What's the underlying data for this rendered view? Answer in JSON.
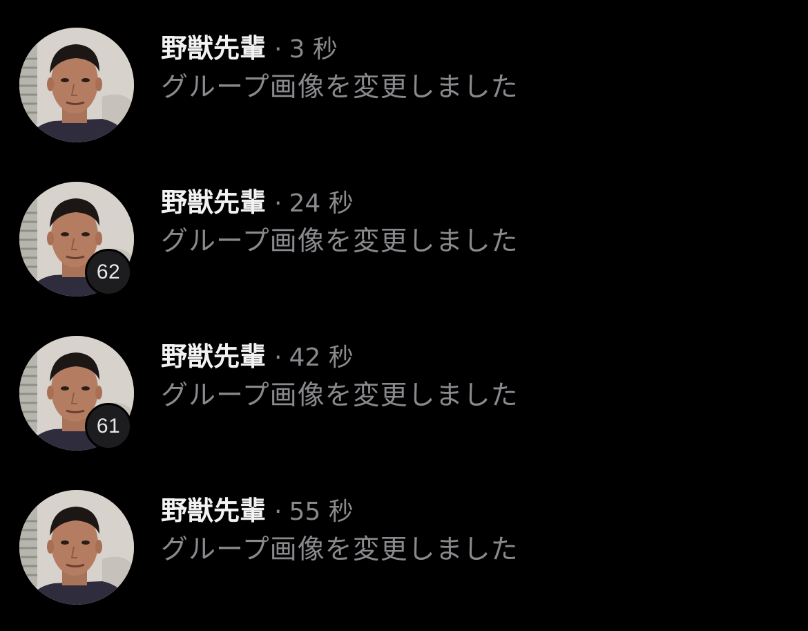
{
  "notifications": [
    {
      "name": "野獣先輩",
      "separator": "·",
      "time": "3 秒",
      "message": "グループ画像を変更しました",
      "badge": null
    },
    {
      "name": "野獣先輩",
      "separator": "·",
      "time": "24 秒",
      "message": "グループ画像を変更しました",
      "badge": "62"
    },
    {
      "name": "野獣先輩",
      "separator": "·",
      "time": "42 秒",
      "message": "グループ画像を変更しました",
      "badge": "61"
    },
    {
      "name": "野獣先輩",
      "separator": "·",
      "time": "55 秒",
      "message": "グループ画像を変更しました",
      "badge": null
    }
  ],
  "colors": {
    "background": "#000000",
    "name_text": "#f2f2f2",
    "secondary_text": "#8a8a8e",
    "badge_background": "#1d1d1f"
  }
}
